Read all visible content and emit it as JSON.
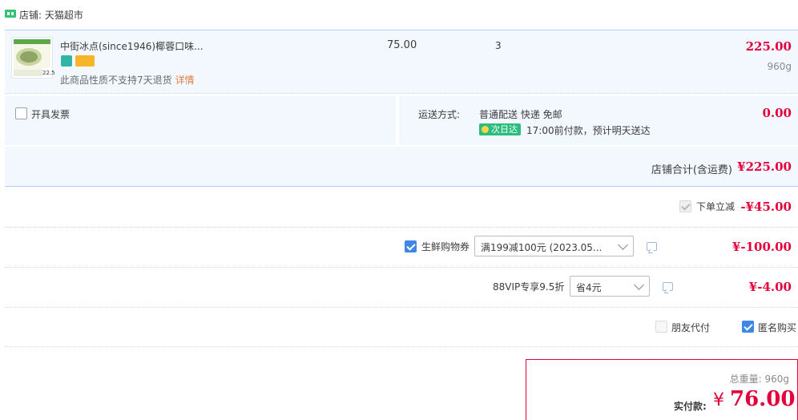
{
  "shop": {
    "label": "店铺: 天猫超市"
  },
  "item": {
    "title": "中街冰点(since1946)椰蓉口味...",
    "thumb_price_tag": "22.5",
    "no_return_text": "此商品性质不支持7天退货",
    "no_return_link": "详情",
    "unit_price": "75.00",
    "quantity": "3",
    "subtotal": "225.00",
    "weight": "960g"
  },
  "invoice": {
    "label": "开具发票"
  },
  "shipping": {
    "label": "运送方式:",
    "method": "普通配送 快递 免邮",
    "next_day_badge": "次日达",
    "delivery_note": "17:00前付款，预计明天送达",
    "fee": "0.00"
  },
  "shop_total": {
    "label": "店铺合计(含运费)",
    "amount": "¥225.00"
  },
  "discounts": {
    "instant": {
      "label": "下单立减",
      "amount": "-¥45.00",
      "checked": true,
      "disabled": true
    },
    "coupon": {
      "label": "生鲜购物券",
      "selected": "满199减100元 (2023.05...",
      "amount": "¥-100.00",
      "checked": true
    },
    "vip": {
      "label": "88VIP专享9.5折",
      "selected": "省4元",
      "amount": "¥-4.00"
    }
  },
  "options": {
    "friend_pay": {
      "label": "朋友代付",
      "checked": false
    },
    "anonymous": {
      "label": "匿名购买",
      "checked": true
    }
  },
  "payment": {
    "total_weight_label": "总重量:",
    "total_weight": "960g",
    "actual_label": "实付款:",
    "currency": "¥",
    "amount": "76.00"
  },
  "colors": {
    "price_red": "#e4003a",
    "accent_blue": "#3f86e6",
    "row_bg": "#f3f7fe",
    "badge_green": "#2bbd7e"
  }
}
